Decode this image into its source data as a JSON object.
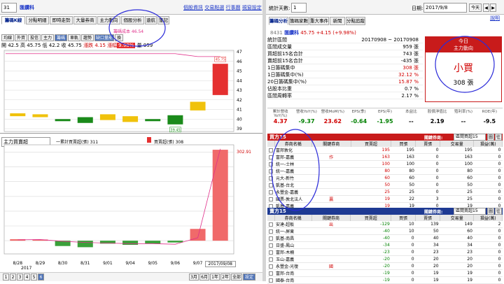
{
  "left": {
    "code_select": "31",
    "stock_name": "匯鑽科",
    "toplinks": [
      "個股資訊",
      "交易點選",
      "行事曆",
      "視窗設定"
    ],
    "tabs": [
      "籌碼K線",
      "分點明細",
      "即時走勢",
      "大量券商",
      "主力動向",
      "個股分析",
      "遠航",
      "筆記"
    ],
    "toolbar": [
      "均線",
      "外資",
      "投信",
      "主力",
      "籌碼",
      "車軌",
      "趨勢",
      "缺口量能",
      "換"
    ],
    "ohlc": {
      "open": "開 42.5",
      "high": "高 45.75",
      "low": "低 42.2",
      "close": "收 45.75",
      "change": "漲跌 4.15",
      "pct_label": "漲幅",
      "pct": "9.98%",
      "vol_label": "量",
      "vol": "959"
    },
    "cost_label": "籌碼成本 46.54",
    "price_axis": [
      "47",
      "46",
      "45",
      "44",
      "43",
      "42",
      "41",
      "40",
      "39"
    ],
    "hi_box": "45.75",
    "lo_box": "39.45",
    "mid_select": "主力買賣超",
    "legend_a": "一累計買賣超(張) 311",
    "legend_b": "買賣超(張) 308",
    "vol_axis": "302.91",
    "dates": [
      "8/28",
      "8/29",
      "8/30",
      "8/31",
      "9/01",
      "9/04",
      "9/05",
      "9/06",
      "9/07",
      "2017/09/08"
    ],
    "year": "2017",
    "page_buttons": [
      "1",
      "2",
      "3",
      "4",
      "5",
      "6"
    ],
    "range_buttons": [
      "3月",
      "6月",
      "1年",
      "2年",
      "全部",
      "設定"
    ]
  },
  "right": {
    "days_label": "統計天數:",
    "days_value": "1",
    "date_label": "日期:",
    "date_value": "2017/9/8",
    "today_btn": "今天",
    "nav_prev": "◀",
    "nav_next": "▶",
    "help": "說明",
    "tabs": [
      "籌碼分析",
      "籌碼家數",
      "重大事件",
      "新聞",
      "分點追蹤"
    ],
    "stock_code": "8431",
    "stock_name": "匯鑽科",
    "stock_price": "45.75",
    "stock_change": "+4.15 (+9.98%)",
    "stats": [
      {
        "label": "統計區間",
        "value": "20170908 ~ 20170908"
      },
      {
        "label": "區間成交量",
        "value": "959 張"
      },
      {
        "label": "買超前15名合計",
        "value": "743 張"
      },
      {
        "label": "賣超前15名合計",
        "value": "-435 張"
      },
      {
        "label": "1日籌碼集中",
        "value": "308 張"
      },
      {
        "label": "1日籌碼集中(%)",
        "value": "32.12 %"
      },
      {
        "label": "20日籌碼集中(%)",
        "value": "15.87 %"
      },
      {
        "label": "佔股本比重",
        "value": "0.7 %"
      },
      {
        "label": "區間周轉率",
        "value": "2.17 %"
      }
    ],
    "today_box": {
      "title": "今日",
      "sub": "主力動向",
      "verdict": "小買",
      "amount": "308 張"
    },
    "metrics": [
      {
        "label": "累計營收YoY(%)",
        "value": "4.37",
        "color": "#d00000"
      },
      {
        "label": "營收YoY(%)",
        "value": "-9.37",
        "color": "#008000"
      },
      {
        "label": "營收MoM(%)",
        "value": "23.62",
        "color": "#d00000"
      },
      {
        "label": "EPS(季)",
        "value": "-0.64",
        "color": "#008000"
      },
      {
        "label": "EPS(年)",
        "value": "-1.95",
        "color": "#008000"
      },
      {
        "label": "本益比",
        "value": "--",
        "color": "#000000"
      },
      {
        "label": "股價淨值比",
        "value": "2.19",
        "color": "#000000"
      },
      {
        "label": "殖利率(%)",
        "value": "--",
        "color": "#000000"
      },
      {
        "label": "ROE(年)",
        "value": "-9.5",
        "color": "#000000"
      }
    ],
    "buy": {
      "title": "買方15",
      "filter_label": "關鍵券商:",
      "filter_value": "區間買超15",
      "btns": [
        "圖",
        "往"
      ],
      "headers": [
        "券商名稱",
        "關鍵券商",
        "買賣超",
        "買張",
        "賣張",
        "交易量",
        "損益(萬)"
      ],
      "rows": [
        {
          "name": "富邦敦化",
          "key": "",
          "net": "195",
          "buy": "195",
          "sell": "0",
          "vol": "195",
          "pnl": "0"
        },
        {
          "name": "富邦-嘉義",
          "key": "作",
          "net": "163",
          "buy": "163",
          "sell": "0",
          "vol": "163",
          "pnl": "0"
        },
        {
          "name": "統一-士林",
          "key": "",
          "net": "100",
          "buy": "100",
          "sell": "0",
          "vol": "100",
          "pnl": "0"
        },
        {
          "name": "統一-嘉義",
          "key": "",
          "net": "80",
          "buy": "80",
          "sell": "0",
          "vol": "80",
          "pnl": "0"
        },
        {
          "name": "元大-新竹",
          "key": "",
          "net": "60",
          "buy": "60",
          "sell": "0",
          "vol": "60",
          "pnl": "0"
        },
        {
          "name": "凱基-台北",
          "key": "",
          "net": "50",
          "buy": "50",
          "sell": "0",
          "vol": "50",
          "pnl": "0"
        },
        {
          "name": "永豐金-嘉義",
          "key": "",
          "net": "25",
          "buy": "25",
          "sell": "0",
          "vol": "25",
          "pnl": "0"
        },
        {
          "name": "國票-敦北法人",
          "key": "贏",
          "net": "19",
          "buy": "22",
          "sell": "3",
          "vol": "25",
          "pnl": "0"
        },
        {
          "name": "凱基-嘉義",
          "key": "",
          "net": "19",
          "buy": "19",
          "sell": "0",
          "vol": "19",
          "pnl": "0"
        }
      ]
    },
    "sell": {
      "title": "賣方15",
      "filter_label": "關鍵券商:",
      "filter_value": "區間賣超15",
      "btns": [
        "圖",
        "往"
      ],
      "headers": [
        "券商名稱",
        "關鍵券商",
        "買賣超",
        "買張",
        "賣張",
        "交易量",
        "損益(萬)"
      ],
      "rows": [
        {
          "name": "安達-超板",
          "key": "出",
          "net": "-129",
          "buy": "10",
          "sell": "139",
          "vol": "149",
          "pnl": "2"
        },
        {
          "name": "統一-屏東",
          "key": "",
          "net": "-40",
          "buy": "10",
          "sell": "50",
          "vol": "60",
          "pnl": "0"
        },
        {
          "name": "凱基-南昌",
          "key": "",
          "net": "-40",
          "buy": "0",
          "sell": "40",
          "vol": "40",
          "pnl": "0"
        },
        {
          "name": "日盛-鳳山",
          "key": "",
          "net": "-34",
          "buy": "0",
          "sell": "34",
          "vol": "34",
          "pnl": "0"
        },
        {
          "name": "富邦-木柵",
          "key": "",
          "net": "-23",
          "buy": "0",
          "sell": "23",
          "vol": "23",
          "pnl": "0"
        },
        {
          "name": "玉山-嘉義",
          "key": "",
          "net": "-20",
          "buy": "0",
          "sell": "20",
          "vol": "20",
          "pnl": "0"
        },
        {
          "name": "永豐金-光復",
          "key": "國",
          "net": "-20",
          "buy": "0",
          "sell": "20",
          "vol": "20",
          "pnl": "0"
        },
        {
          "name": "富邦-台南",
          "key": "",
          "net": "-19",
          "buy": "0",
          "sell": "19",
          "vol": "19",
          "pnl": "0"
        },
        {
          "name": "國泰-台南",
          "key": "",
          "net": "-19",
          "buy": "0",
          "sell": "19",
          "vol": "19",
          "pnl": "0"
        }
      ]
    }
  },
  "colors": {
    "up": "#e53030",
    "down": "#1a8a1a",
    "flat": "#f0c20c",
    "accent": "#c81b1b",
    "sell_header": "#1e3a93"
  },
  "chart_data": {
    "type": "candlestick",
    "categories": [
      "8/28",
      "8/29",
      "8/30",
      "8/31",
      "9/01",
      "9/04",
      "9/05",
      "9/06",
      "9/07",
      "9/08"
    ],
    "candles": [
      {
        "o": 40.6,
        "c": 40.3,
        "color": "flat"
      },
      {
        "o": 40.5,
        "c": 40.2,
        "color": "flat"
      },
      {
        "o": 40.0,
        "c": 39.8,
        "color": "down"
      },
      {
        "o": 40.2,
        "c": 39.6,
        "color": "down"
      },
      {
        "o": 40.5,
        "c": 39.9,
        "color": "flat"
      },
      {
        "o": 40.3,
        "c": 39.7,
        "color": "flat"
      },
      {
        "o": 40.0,
        "c": 39.8,
        "color": "down"
      },
      {
        "o": 40.4,
        "c": 39.45,
        "color": "down"
      },
      {
        "o": 40.9,
        "c": 41.8,
        "color": "flat"
      },
      {
        "o": 42.5,
        "c": 45.75,
        "color": "up"
      }
    ],
    "net_buy": [
      5,
      4,
      -18,
      -22,
      -10,
      -14,
      -10,
      -6,
      40,
      308
    ],
    "cumulative": [
      3,
      4,
      -2,
      -6,
      -8,
      -10,
      -10,
      -12,
      10,
      311
    ],
    "ylim_price": [
      39,
      47
    ],
    "ylim_vol": [
      -40,
      320
    ]
  }
}
